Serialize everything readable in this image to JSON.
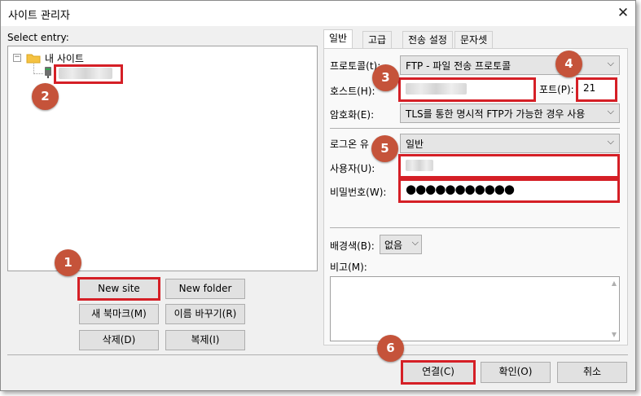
{
  "window": {
    "title": "사이트 관리자",
    "close_glyph": "✕"
  },
  "left": {
    "select_entry_label": "Select entry:",
    "tree": {
      "root_label": "내 사이트",
      "child_label": ""
    },
    "buttons": {
      "new_site": "New site",
      "new_folder": "New folder",
      "new_bookmark": "새 북마크(M)",
      "rename": "이름 바꾸기(R)",
      "delete": "삭제(D)",
      "duplicate": "복제(I)"
    }
  },
  "tabs": [
    "일반",
    "고급",
    "전송 설정",
    "문자셋"
  ],
  "general": {
    "protocol_label": "프로토콜(t):",
    "protocol_value": "FTP - 파일 전송 프로토콜",
    "host_label": "호스트(H):",
    "host_value": "",
    "port_label": "포트(P):",
    "port_value": "21",
    "encryption_label": "암호화(E):",
    "encryption_value": "TLS를 통한 명시적 FTP가 가능한 경우 사용",
    "logon_type_label": "로그온 유",
    "logon_type_value": "일반",
    "user_label": "사용자(U):",
    "user_value": "",
    "password_label": "비밀번호(W):",
    "password_value": "●●●●●●●●●●●",
    "background_label": "배경색(B):",
    "background_value": "없음",
    "comments_label": "비고(M):"
  },
  "footer": {
    "connect": "연결(C)",
    "ok": "확인(O)",
    "cancel": "취소"
  },
  "annotations": [
    "1",
    "2",
    "3",
    "4",
    "5",
    "6"
  ],
  "colors": {
    "highlight": "#d51f26",
    "badge": "#c5533a",
    "folder": "#f5c242"
  }
}
